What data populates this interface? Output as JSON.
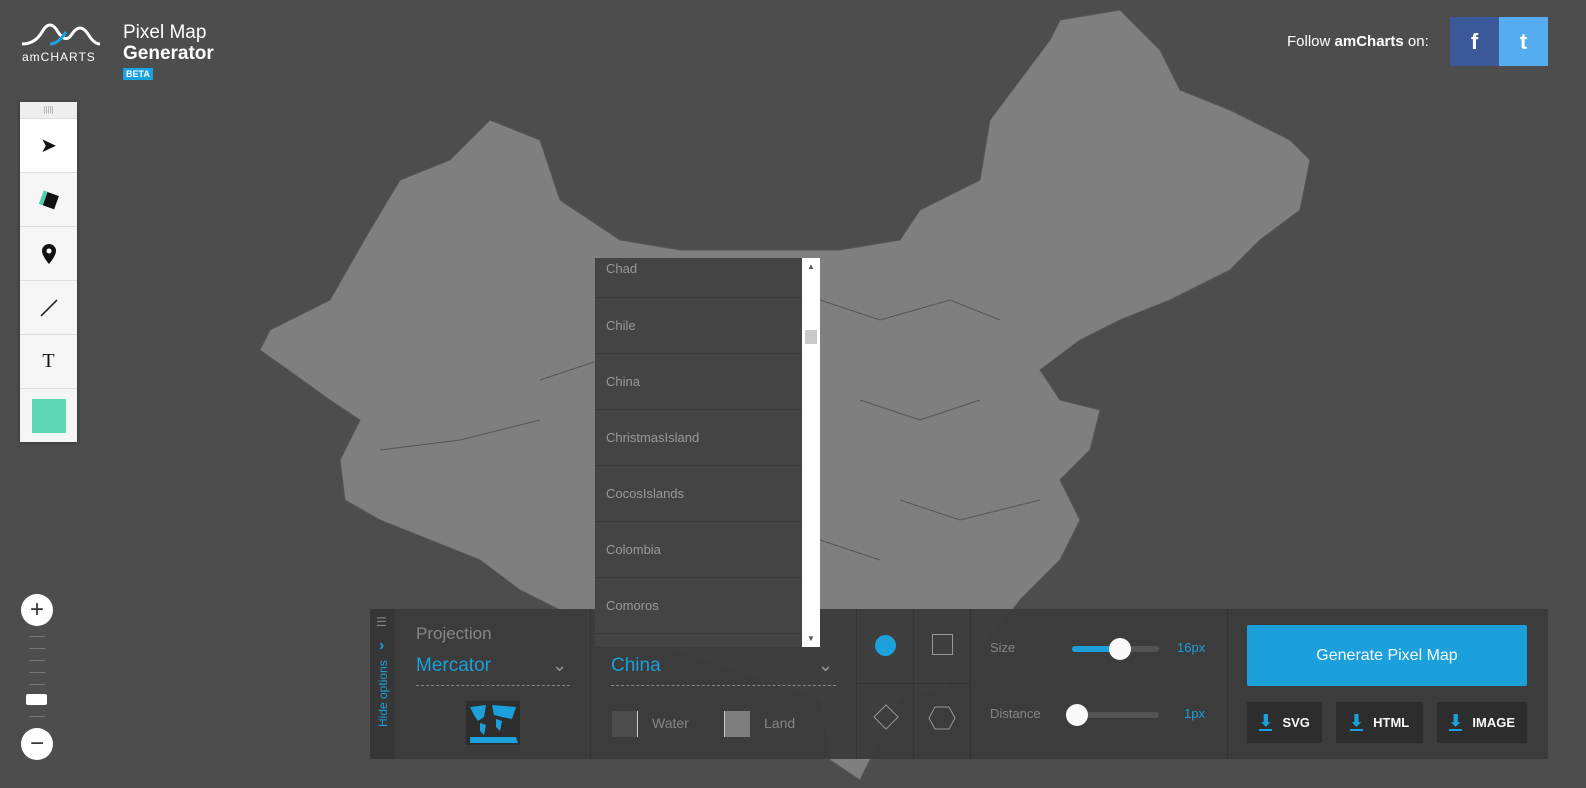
{
  "logo": {
    "brand": "amCHARTS",
    "title_line1": "Pixel Map",
    "title_line2": "Generator",
    "badge": "BETA"
  },
  "social": {
    "follow_prefix": "Follow ",
    "follow_brand": "amCharts",
    "follow_suffix": " on:",
    "facebook": "f",
    "twitter": "t"
  },
  "tools": [
    "select-tool",
    "fill-tool",
    "marker-tool",
    "line-tool",
    "text-tool",
    "pattern-tool"
  ],
  "tool_text_label": "T",
  "zoom": {
    "in": "+",
    "out": "−"
  },
  "country_list": {
    "items": [
      "Chad",
      "Chile",
      "China",
      "ChristmasIsland",
      "CocosIslands",
      "Colombia",
      "Comoros"
    ]
  },
  "panel": {
    "hide_options": "Hide options",
    "projection_label": "Projection",
    "projection_value": "Mercator",
    "country_value": "China",
    "water_label": "Water",
    "land_label": "Land",
    "water_color": "#4d4d4d",
    "land_color": "#808080",
    "size_label": "Size",
    "size_value": "16px",
    "size_fraction": 0.55,
    "distance_label": "Distance",
    "distance_value": "1px",
    "distance_fraction": 0.0,
    "generate": "Generate Pixel Map",
    "downloads": [
      "SVG",
      "HTML",
      "IMAGE"
    ]
  },
  "colors": {
    "accent": "#1aa3e0",
    "background": "#4d4d4d",
    "land": "#808080"
  }
}
